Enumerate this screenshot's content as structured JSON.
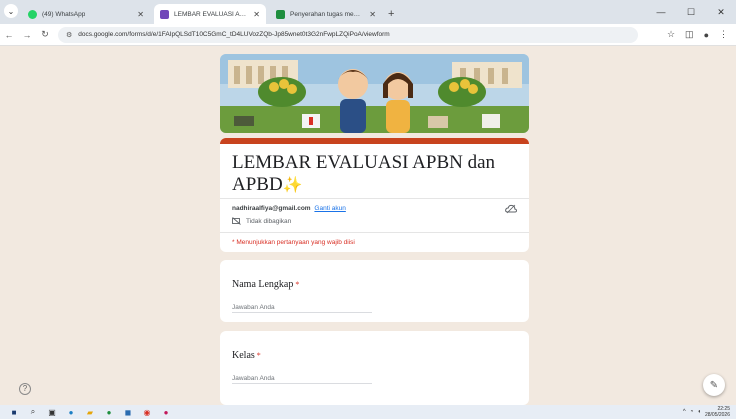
{
  "browser": {
    "tabs": [
      {
        "title": "(49) WhatsApp",
        "favicon_color": "#25d366",
        "active": false
      },
      {
        "title": "LEMBAR EVALUASI APBN dan A",
        "favicon_color": "#7248b9",
        "active": true
      },
      {
        "title": "Penyerahan tugas mengolah h",
        "favicon_color": "#1e8e3e",
        "active": false
      }
    ],
    "new_tab_label": "+",
    "url": "docs.google.com/forms/d/e/1FAIpQLSdT10C5GmC_tD4LUVozZQb-Jp85wnet0t3G2nFwpLZQiPoA/viewform"
  },
  "form": {
    "title": "LEMBAR EVALUASI APBN dan APBD",
    "title_emoji": "✨",
    "email": "nadhiraalfiya@gmail.com",
    "switch_account": "Ganti akun",
    "not_shared": "Tidak dibagikan",
    "required_note": "* Menunjukkan pertanyaan yang wajib diisi",
    "accent_color": "#c8431e",
    "questions": [
      {
        "label": "Nama Lengkap",
        "required_mark": "*",
        "placeholder": "Jawaban Anda"
      },
      {
        "label": "Kelas",
        "required_mark": "*",
        "placeholder": "Jawaban Anda"
      }
    ]
  },
  "taskbar": {
    "time": "22:25",
    "date": "28/05/2026"
  }
}
